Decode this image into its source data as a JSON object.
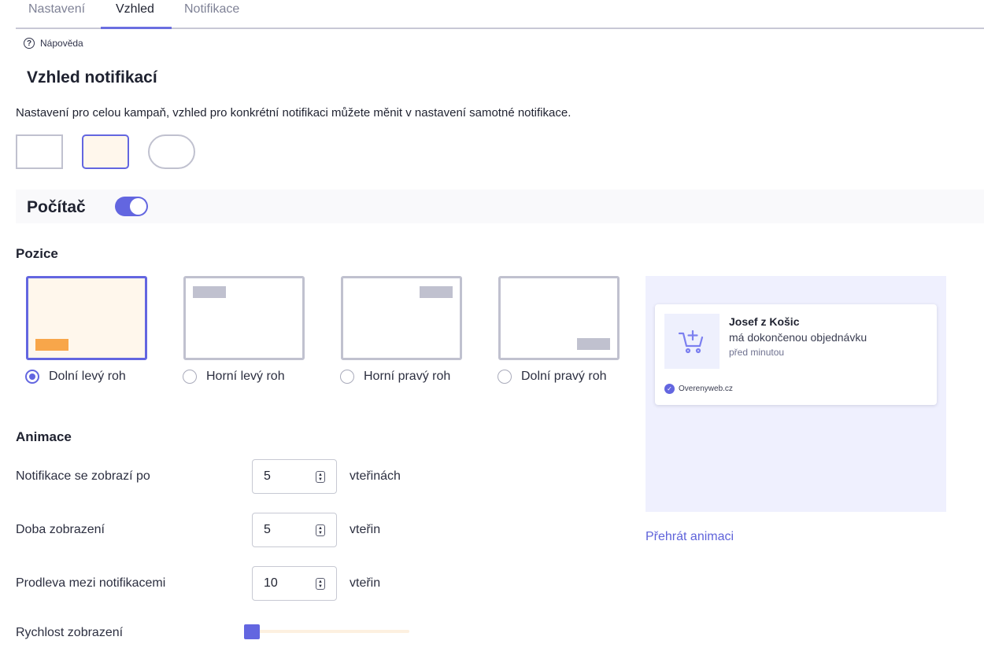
{
  "tabs": [
    {
      "label": "Nastavení",
      "active": false
    },
    {
      "label": "Vzhled",
      "active": true
    },
    {
      "label": "Notifikace",
      "active": false
    }
  ],
  "help": {
    "label": "Nápověda",
    "icon": "question-circle-icon"
  },
  "page": {
    "title": "Vzhled notifikací",
    "description": "Nastavení pro celou kampaň, vzhled pro konkrétní notifikaci můžete měnit v nastavení samotné notifikace.",
    "shapes": [
      {
        "id": "square",
        "selected": false
      },
      {
        "id": "rounded",
        "selected": true
      },
      {
        "id": "pill",
        "selected": false
      }
    ]
  },
  "device_section": {
    "title": "Počítač",
    "enabled": true
  },
  "position": {
    "title": "Pozice",
    "options": [
      {
        "label": "Dolní levý roh",
        "selected": true
      },
      {
        "label": "Horní levý roh",
        "selected": false
      },
      {
        "label": "Horní pravý roh",
        "selected": false
      },
      {
        "label": "Dolní pravý roh",
        "selected": false
      }
    ]
  },
  "animation": {
    "title": "Animace",
    "fields": [
      {
        "label": "Notifikace se zobrazí po",
        "value": "5",
        "unit": "vteřinách"
      },
      {
        "label": "Doba zobrazení",
        "value": "5",
        "unit": "vteřin"
      },
      {
        "label": "Prodleva mezi notifikacemi",
        "value": "10",
        "unit": "vteřin"
      }
    ],
    "speed": {
      "label": "Rychlost zobrazení",
      "value_fraction": 0.0
    }
  },
  "preview": {
    "name": "Josef z Košic",
    "action": "má dokončenou objednávku",
    "time": "před minutou",
    "brand": "Overenyweb.cz",
    "icon": "cart-plus-icon",
    "play_label": "Přehrát animaci"
  },
  "colors": {
    "accent": "#6366e0",
    "selected_bg": "#fff7ec",
    "marker_orange": "#f8a64a",
    "preview_bg": "#eff0fe"
  }
}
